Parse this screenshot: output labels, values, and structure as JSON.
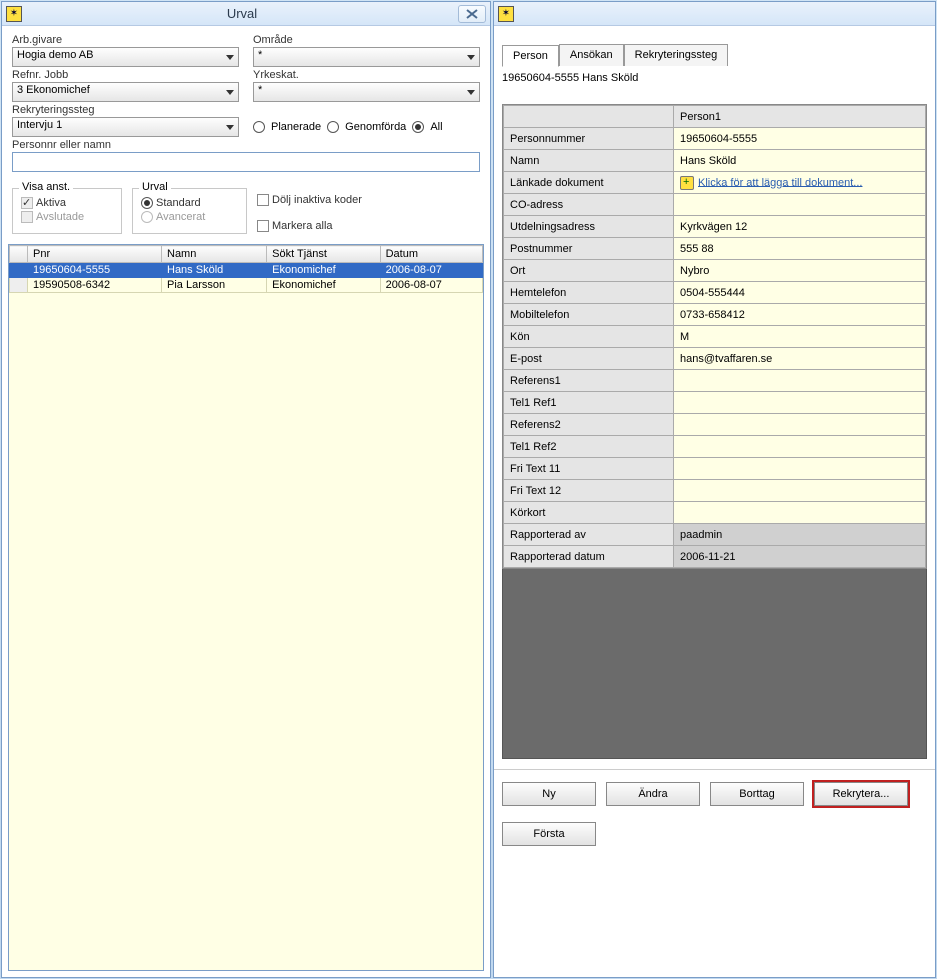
{
  "left": {
    "title": "Urval",
    "labels": {
      "arbgivare": "Arb.givare",
      "omrade": "Område",
      "refnr": "Refnr. Jobb",
      "yrkeskat": "Yrkeskat.",
      "rekryteringssteg": "Rekryteringssteg",
      "personnr": "Personnr eller namn"
    },
    "values": {
      "arbgivare": "Hogia demo AB",
      "omrade": "*",
      "refnr": "3   Ekonomichef",
      "yrkeskat": "*",
      "rekryteringssteg": "Intervju 1"
    },
    "radios": {
      "planerade": "Planerade",
      "genomforda": "Genomförda",
      "all": "All"
    },
    "groups": {
      "visa": "Visa anst.",
      "aktiva": "Aktiva",
      "avslutade": "Avslutade",
      "urval": "Urval",
      "standard": "Standard",
      "avancerat": "Avancerat",
      "dolj": "Dölj inaktiva koder",
      "markera": "Markera alla"
    },
    "table": {
      "headers": [
        "Pnr",
        "Namn",
        "Sökt Tjänst",
        "Datum"
      ],
      "rows": [
        {
          "pnr": "19650604-5555",
          "namn": "Hans Sköld",
          "tjanst": "Ekonomichef",
          "datum": "2006-08-07",
          "selected": true
        },
        {
          "pnr": "19590508-6342",
          "namn": "Pia Larsson",
          "tjanst": "Ekonomichef",
          "datum": "2006-08-07",
          "selected": false
        }
      ]
    }
  },
  "right": {
    "tabs": [
      "Person",
      "Ansökan",
      "Rekryteringssteg"
    ],
    "activeTab": 0,
    "personTitle": "19650604-5555 Hans Sköld",
    "columnHeader": "Person1",
    "fields": [
      {
        "label": "Personnummer",
        "value": "19650604-5555"
      },
      {
        "label": "Namn",
        "value": "Hans Sköld"
      },
      {
        "label": "Länkade dokument",
        "value": "Klicka för att lägga till dokument...",
        "link": true
      },
      {
        "label": "CO-adress",
        "value": ""
      },
      {
        "label": "Utdelningsadress",
        "value": "Kyrkvägen 12"
      },
      {
        "label": "Postnummer",
        "value": "555 88"
      },
      {
        "label": "Ort",
        "value": "Nybro"
      },
      {
        "label": "Hemtelefon",
        "value": "0504-555444"
      },
      {
        "label": "Mobiltelefon",
        "value": "0733-658412"
      },
      {
        "label": "Kön",
        "value": "M"
      },
      {
        "label": "E-post",
        "value": "hans@tvaffaren.se"
      },
      {
        "label": "Referens1",
        "value": ""
      },
      {
        "label": "Tel1 Ref1",
        "value": ""
      },
      {
        "label": "Referens2",
        "value": ""
      },
      {
        "label": "Tel1 Ref2",
        "value": ""
      },
      {
        "label": "Fri Text 11",
        "value": ""
      },
      {
        "label": "Fri Text 12",
        "value": ""
      },
      {
        "label": "Körkort",
        "value": ""
      },
      {
        "label": "Rapporterad av",
        "value": "paadmin",
        "grey": true
      },
      {
        "label": "Rapporterad datum",
        "value": "2006-11-21",
        "grey": true
      }
    ],
    "buttons": {
      "ny": "Ny",
      "andra": "Ändra",
      "borttag": "Borttag",
      "rekrytera": "Rekrytera...",
      "forsta": "Första"
    }
  }
}
